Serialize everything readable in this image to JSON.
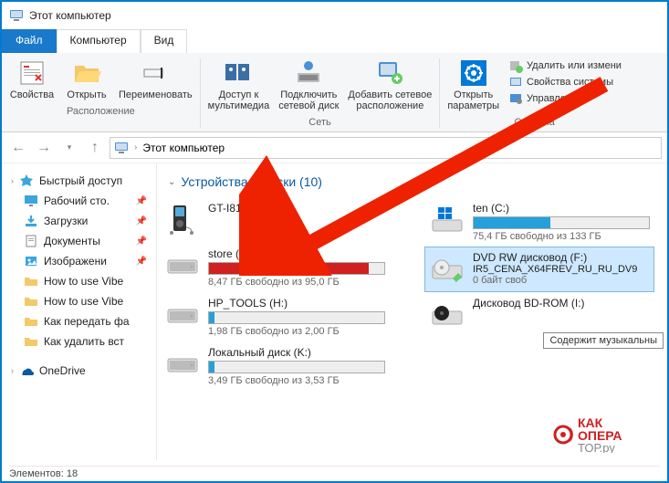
{
  "window": {
    "title": "Этот компьютер"
  },
  "tabs": {
    "file": "Файл",
    "computer": "Компьютер",
    "view": "Вид"
  },
  "ribbon": {
    "group_location": "Расположение",
    "group_network": "Сеть",
    "group_system": "Система",
    "props": "Свойства",
    "open": "Открыть",
    "rename": "Переименовать",
    "media": "Доступ к\nмультимедиа",
    "mapdrive": "Подключить\nсетевой диск",
    "addnet": "Добавить сетевое\nрасположение",
    "openparams": "Открыть\nпараметры",
    "uninstall": "Удалить или измени",
    "sysprops": "Свойства системы",
    "manage": "Управление"
  },
  "address": {
    "path": "Этот компьютер"
  },
  "sidebar": {
    "quick": "Быстрый доступ",
    "items": [
      {
        "label": "Рабочий сто.",
        "icon": "desktop"
      },
      {
        "label": "Загрузки",
        "icon": "downloads"
      },
      {
        "label": "Документы",
        "icon": "documents"
      },
      {
        "label": "Изображени",
        "icon": "pictures"
      },
      {
        "label": "How to use Vibe",
        "icon": "folder"
      },
      {
        "label": "How to use Vibe",
        "icon": "folder"
      },
      {
        "label": "Как передать фа",
        "icon": "folder"
      },
      {
        "label": "Как удалить вст",
        "icon": "folder"
      }
    ],
    "onedrive": "OneDrive"
  },
  "section": {
    "title": "Устройства и диски (10)"
  },
  "drives": {
    "gt": {
      "name": "GT-I8160"
    },
    "ten": {
      "name": "ten (C:)",
      "free": "75,4 ГБ свободно из 133 ГБ",
      "fill": 44,
      "color": "#26a0da"
    },
    "store": {
      "name": "store (E:)",
      "free": "8,47 ГБ свободно из 95,0 ГБ",
      "fill": 91,
      "color": "#d02020"
    },
    "dvd": {
      "name": "DVD RW дисковод (F:)",
      "sub": "IR5_CENA_X64FREV_RU_RU_DV9",
      "free": "0 байт своб"
    },
    "hp": {
      "name": "HP_TOOLS (H:)",
      "free": "1,98 ГБ свободно из 2,00 ГБ",
      "fill": 3,
      "color": "#26a0da"
    },
    "bd": {
      "name": "Дисковод BD-ROM (I:)"
    },
    "k": {
      "name": "Локальный диск (K:)",
      "free": "3,49 ГБ свободно из 3,53 ГБ",
      "fill": 3,
      "color": "#26a0da"
    }
  },
  "tooltip": {
    "text": "Содержит музыкальны"
  },
  "status": {
    "text": "Элементов: 18"
  },
  "watermark": {
    "line1": "КАК",
    "line2": "ОПЕРА",
    "line3": "ТОР.ру"
  }
}
